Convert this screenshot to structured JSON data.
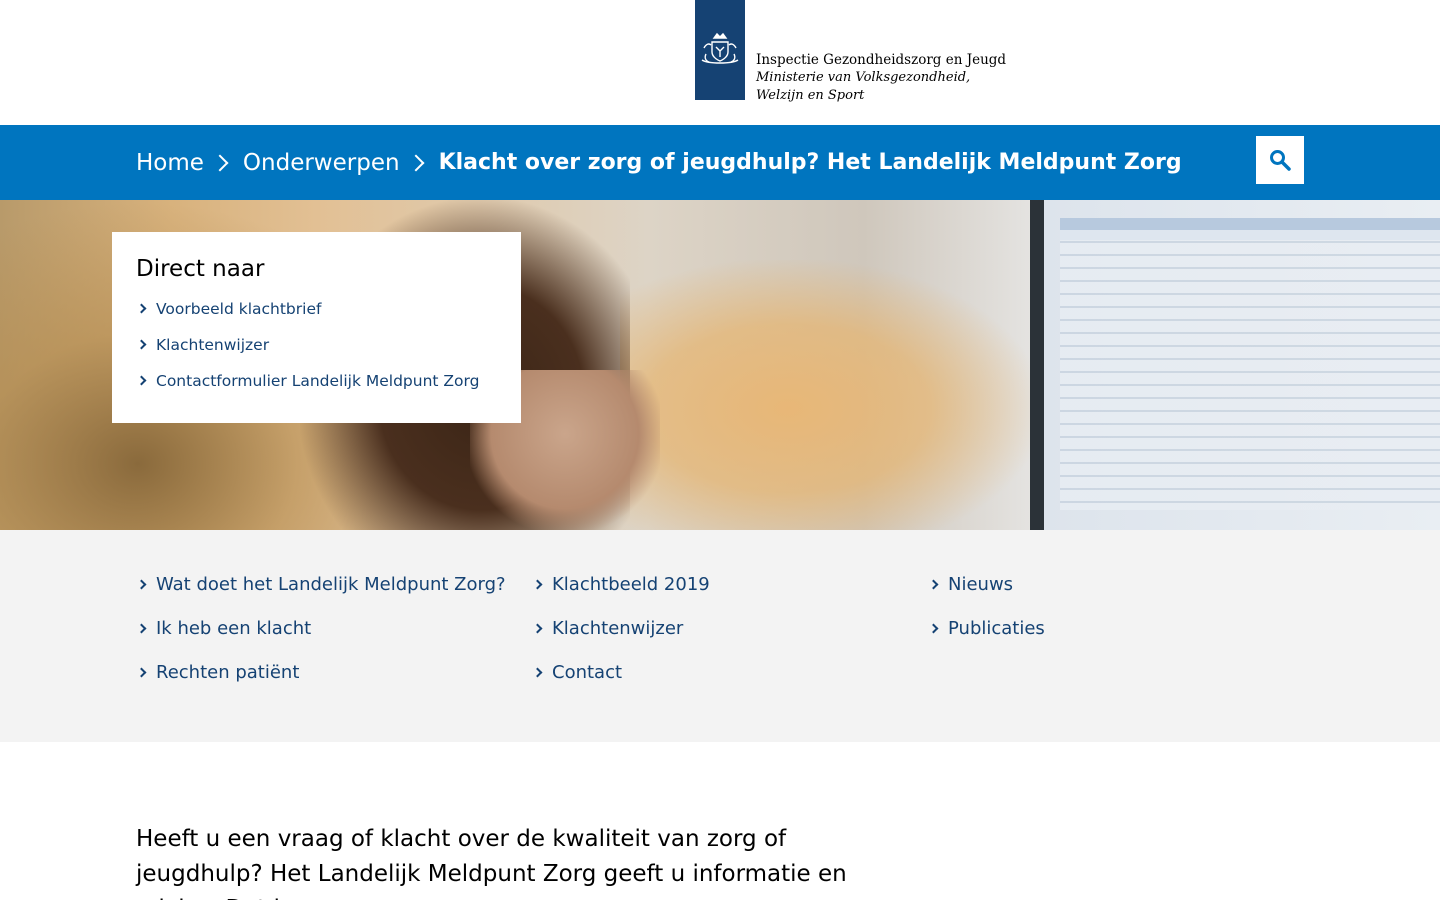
{
  "header": {
    "logo_org": "Inspectie Gezondheidszorg en Jeugd",
    "logo_ministry_line1": "Ministerie van Volksgezondheid,",
    "logo_ministry_line2": "Welzijn en Sport",
    "logo_icon": "coat-of-arms-icon",
    "brand_color": "#154273"
  },
  "breadcrumb": {
    "items": [
      {
        "label": "Home"
      },
      {
        "label": "Onderwerpen"
      }
    ],
    "current": "Klacht over zorg of jeugdhulp? Het Landelijk Meldpunt Zorg",
    "bar_color": "#0075bf",
    "search_icon": "search-icon"
  },
  "direct": {
    "title": "Direct naar",
    "links": [
      {
        "label": "Voorbeeld klachtbrief"
      },
      {
        "label": "Klachtenwijzer"
      },
      {
        "label": "Contactformulier Landelijk Meldpunt Zorg"
      }
    ]
  },
  "quicklinks": {
    "col1": [
      {
        "label": "Wat doet het Landelijk Meldpunt Zorg?"
      },
      {
        "label": "Ik heb een klacht"
      },
      {
        "label": "Rechten patiënt"
      }
    ],
    "col2": [
      {
        "label": "Klachtbeeld 2019"
      },
      {
        "label": "Klachtenwijzer"
      },
      {
        "label": "Contact"
      }
    ],
    "col3": [
      {
        "label": "Nieuws"
      },
      {
        "label": "Publicaties"
      }
    ]
  },
  "intro": {
    "text": "Heeft u een vraag of klacht over de kwaliteit van zorg of jeugdhulp? Het Landelijk Meldpunt Zorg geeft u informatie en advies. Dat kan gaan"
  }
}
